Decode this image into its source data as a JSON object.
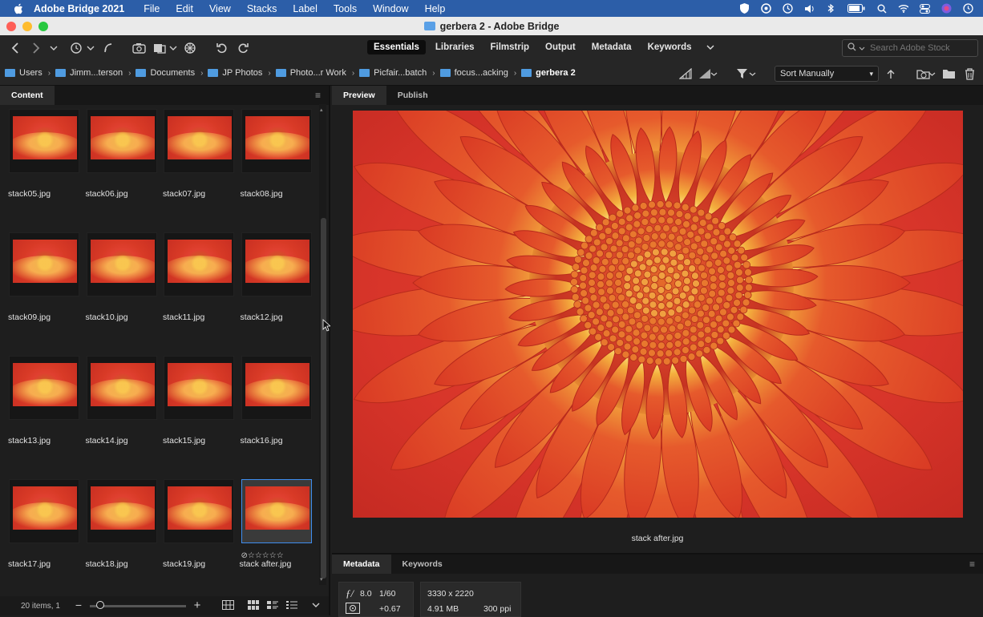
{
  "menubar": {
    "app_name": "Adobe Bridge 2021",
    "items": [
      "File",
      "Edit",
      "View",
      "Stacks",
      "Label",
      "Tools",
      "Window",
      "Help"
    ]
  },
  "window": {
    "title": "gerbera 2 - Adobe Bridge"
  },
  "workspaces": {
    "tabs": [
      "Essentials",
      "Libraries",
      "Filmstrip",
      "Output",
      "Metadata",
      "Keywords"
    ],
    "active": "Essentials"
  },
  "search": {
    "placeholder": "Search Adobe Stock"
  },
  "breadcrumb": [
    "Users",
    "Jimm...terson",
    "Documents",
    "JP Photos",
    "Photo...r Work",
    "Picfair...batch",
    "focus...acking",
    "gerbera 2"
  ],
  "sort": {
    "label": "Sort Manually"
  },
  "content_panel": {
    "tab_label": "Content",
    "files": [
      "stack05.jpg",
      "stack06.jpg",
      "stack07.jpg",
      "stack08.jpg",
      "stack09.jpg",
      "stack10.jpg",
      "stack11.jpg",
      "stack12.jpg",
      "stack13.jpg",
      "stack14.jpg",
      "stack15.jpg",
      "stack16.jpg",
      "stack17.jpg",
      "stack18.jpg",
      "stack19.jpg",
      "stack after.jpg"
    ],
    "selected": "stack after.jpg",
    "footer_status": "20 items, 1"
  },
  "preview_panel": {
    "tabs": [
      "Preview",
      "Publish"
    ],
    "active": "Preview",
    "caption": "stack after.jpg"
  },
  "metadata_panel": {
    "tabs": [
      "Metadata",
      "Keywords"
    ],
    "active": "Metadata",
    "aperture": "8.0",
    "shutter": "1/60",
    "exposure_comp": "+0.67",
    "dimensions": "3330 x 2220",
    "file_size": "4.91 MB",
    "resolution": "300 ppi"
  },
  "colors": {
    "menubar_bg": "#2c5ea8",
    "accent_selection": "#3f8ef0",
    "folder_blue": "#4f9be0",
    "flower_red": "#d9372b",
    "flower_yellow": "#f2c24a"
  }
}
